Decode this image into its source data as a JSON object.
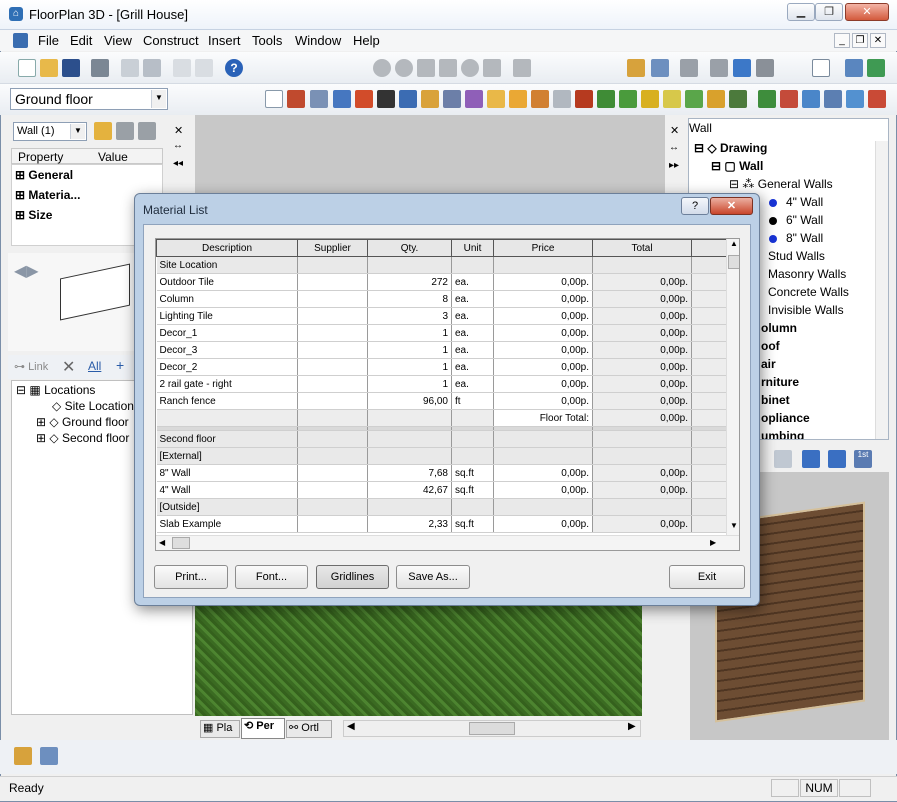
{
  "window": {
    "title": "FloorPlan 3D - [Grill House]",
    "icon": "app-icon"
  },
  "menu": [
    "File",
    "Edit",
    "View",
    "Construct",
    "Insert",
    "Tools",
    "Window",
    "Help"
  ],
  "floor_selector": {
    "value": "Ground floor"
  },
  "left_panel": {
    "wall_combo": "Wall (1)",
    "headers": {
      "property": "Property",
      "value": "Value"
    },
    "groups": [
      "General",
      "Materia...",
      "Size"
    ],
    "link_label": "Link",
    "all_label": "All",
    "locations": {
      "root": "Locations",
      "items": [
        "Site Location",
        "Ground floor",
        "Second floor"
      ]
    }
  },
  "right_panel": {
    "header": "Wall",
    "tree": {
      "drawing": "Drawing",
      "wall": "Wall",
      "general_walls": "General Walls",
      "walls": [
        "4\" Wall",
        "6\" Wall",
        "8\" Wall"
      ],
      "others": [
        "Stud Walls",
        "Masonry Walls",
        "Concrete Walls",
        "Invisible Walls"
      ],
      "categories": [
        "olumn",
        "oof",
        "air",
        "rniture",
        "binet",
        "opliance",
        "umbing"
      ]
    }
  },
  "view_tabs": [
    "Pla",
    "Per",
    "Ortl"
  ],
  "dialog": {
    "title": "Material List",
    "help": "?",
    "columns": [
      "Description",
      "Supplier",
      "Qty.",
      "Unit",
      "Price",
      "Total"
    ],
    "rows": [
      {
        "type": "section",
        "desc": "Site Location"
      },
      {
        "desc": "Outdoor Tile",
        "supplier": "",
        "qty": "272",
        "unit": "ea.",
        "price": "0,00p.",
        "total": "0,00p."
      },
      {
        "desc": "Column",
        "supplier": "",
        "qty": "8",
        "unit": "ea.",
        "price": "0,00p.",
        "total": "0,00p."
      },
      {
        "desc": "Lighting Tile",
        "supplier": "",
        "qty": "3",
        "unit": "ea.",
        "price": "0,00p.",
        "total": "0,00p."
      },
      {
        "desc": "Decor_1",
        "supplier": "",
        "qty": "1",
        "unit": "ea.",
        "price": "0,00p.",
        "total": "0,00p."
      },
      {
        "desc": "Decor_3",
        "supplier": "",
        "qty": "1",
        "unit": "ea.",
        "price": "0,00p.",
        "total": "0,00p."
      },
      {
        "desc": "Decor_2",
        "supplier": "",
        "qty": "1",
        "unit": "ea.",
        "price": "0,00p.",
        "total": "0,00p."
      },
      {
        "desc": "2 rail gate - right",
        "supplier": "",
        "qty": "1",
        "unit": "ea.",
        "price": "0,00p.",
        "total": "0,00p."
      },
      {
        "desc": "Ranch fence",
        "supplier": "",
        "qty": "96,00",
        "unit": "ft",
        "price": "0,00p.",
        "total": "0,00p."
      },
      {
        "type": "floortotal",
        "label": "Floor Total:",
        "total": "0,00p."
      },
      {
        "type": "section",
        "desc": "Second floor"
      },
      {
        "type": "sub",
        "desc": "[External]"
      },
      {
        "desc": "8\" Wall",
        "supplier": "",
        "qty": "7,68",
        "unit": "sq.ft",
        "price": "0,00p.",
        "total": "0,00p."
      },
      {
        "desc": "4\" Wall",
        "supplier": "",
        "qty": "42,67",
        "unit": "sq.ft",
        "price": "0,00p.",
        "total": "0,00p."
      },
      {
        "type": "sub",
        "desc": "[Outside]"
      },
      {
        "desc": "Slab Example",
        "supplier": "",
        "qty": "2,33",
        "unit": "sq.ft",
        "price": "0,00p.",
        "total": "0,00p."
      }
    ],
    "buttons": {
      "print": "Print...",
      "font": "Font...",
      "gridlines": "Gridlines",
      "save_as": "Save As...",
      "exit": "Exit"
    }
  },
  "status": {
    "text": "Ready",
    "num": "NUM"
  }
}
